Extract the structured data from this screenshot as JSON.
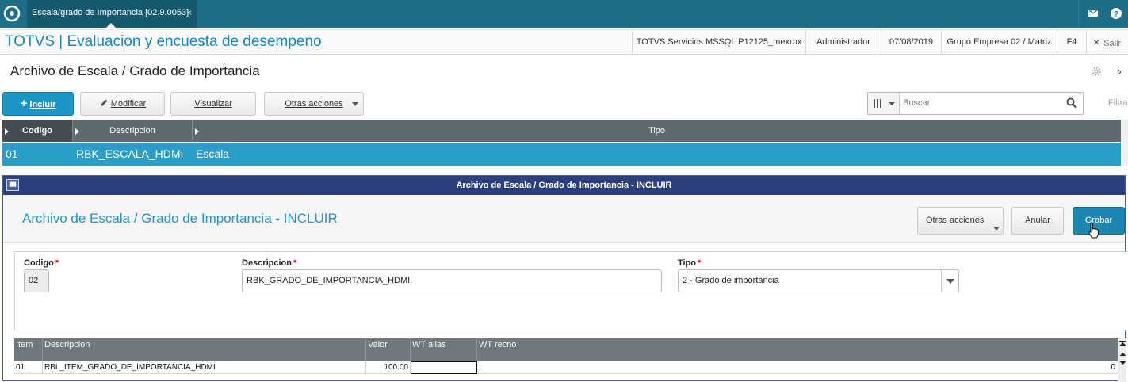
{
  "tabs": [
    {
      "label": "Escala/grado de Importancia [02.9.0053]",
      "close": "×"
    }
  ],
  "header": {
    "app_title": "TOTVS | Evaluacion y encuesta de desempeno",
    "server": "TOTVS Servicios MSSQL P12125_mexrox",
    "user": "Administrador",
    "date": "07/08/2019",
    "company": "Grupo Empresa 02 / Matriz",
    "shortcut": "F4",
    "exit_label": "Salir",
    "exit_icon": "×"
  },
  "page": {
    "title": "Archivo de Escala / Grado de Importancia",
    "close_icon": "›"
  },
  "toolbar": {
    "incluir": "Incluir",
    "modificar": "Modificar",
    "visualizar": "Visualizar",
    "otras_acciones": "Otras acciones",
    "search_placeholder": "Buscar",
    "filter_label": "Filtra"
  },
  "browse": {
    "columns": [
      "Codigo",
      "Descripcion",
      "Tipo"
    ],
    "rows": [
      {
        "codigo": "01",
        "descripcion": "RBK_ESCALA_HDMI",
        "tipo": "Escala"
      }
    ]
  },
  "dialog": {
    "titlebar": "Archivo de Escala / Grado de Importancia - INCLUIR",
    "heading": "Archivo de Escala / Grado de Importancia - INCLUIR",
    "otras_acciones": "Otras acciones",
    "anular": "Anular",
    "grabar": "Grabar",
    "required_mark": "*",
    "fields": {
      "codigo": {
        "label": "Codigo",
        "value": "02"
      },
      "descripcion": {
        "label": "Descripcion",
        "value": "RBK_GRADO_DE_IMPORTANCIA_HDMI"
      },
      "tipo": {
        "label": "Tipo",
        "value": "2 - Grado de importancia"
      }
    },
    "items": {
      "columns": [
        "Item",
        "Descripcion",
        "Valor",
        "WT alias",
        "WT recno"
      ],
      "rows": [
        {
          "item": "01",
          "descripcion": "RBL_ITEM_GRADO_DE_IMPORTANCIA_HDMI",
          "valor": "100.00",
          "wt_alias": "",
          "wt_recno": "0"
        }
      ]
    }
  },
  "colors": {
    "topbar": "#1d6e86",
    "brand_title": "#1f84b8",
    "primary_button": "#1c95c5",
    "selected_row": "#2a9ec9",
    "dialog_titlebar": "#2c3f7c"
  },
  "icons": [
    "totvs-logo-icon",
    "mail-icon",
    "help-icon",
    "gear-icon",
    "plus-icon",
    "pencil-icon",
    "columns-icon",
    "search-icon",
    "window-icon",
    "cursor-icon",
    "scroll-up-icon",
    "scroll-down-icon"
  ]
}
